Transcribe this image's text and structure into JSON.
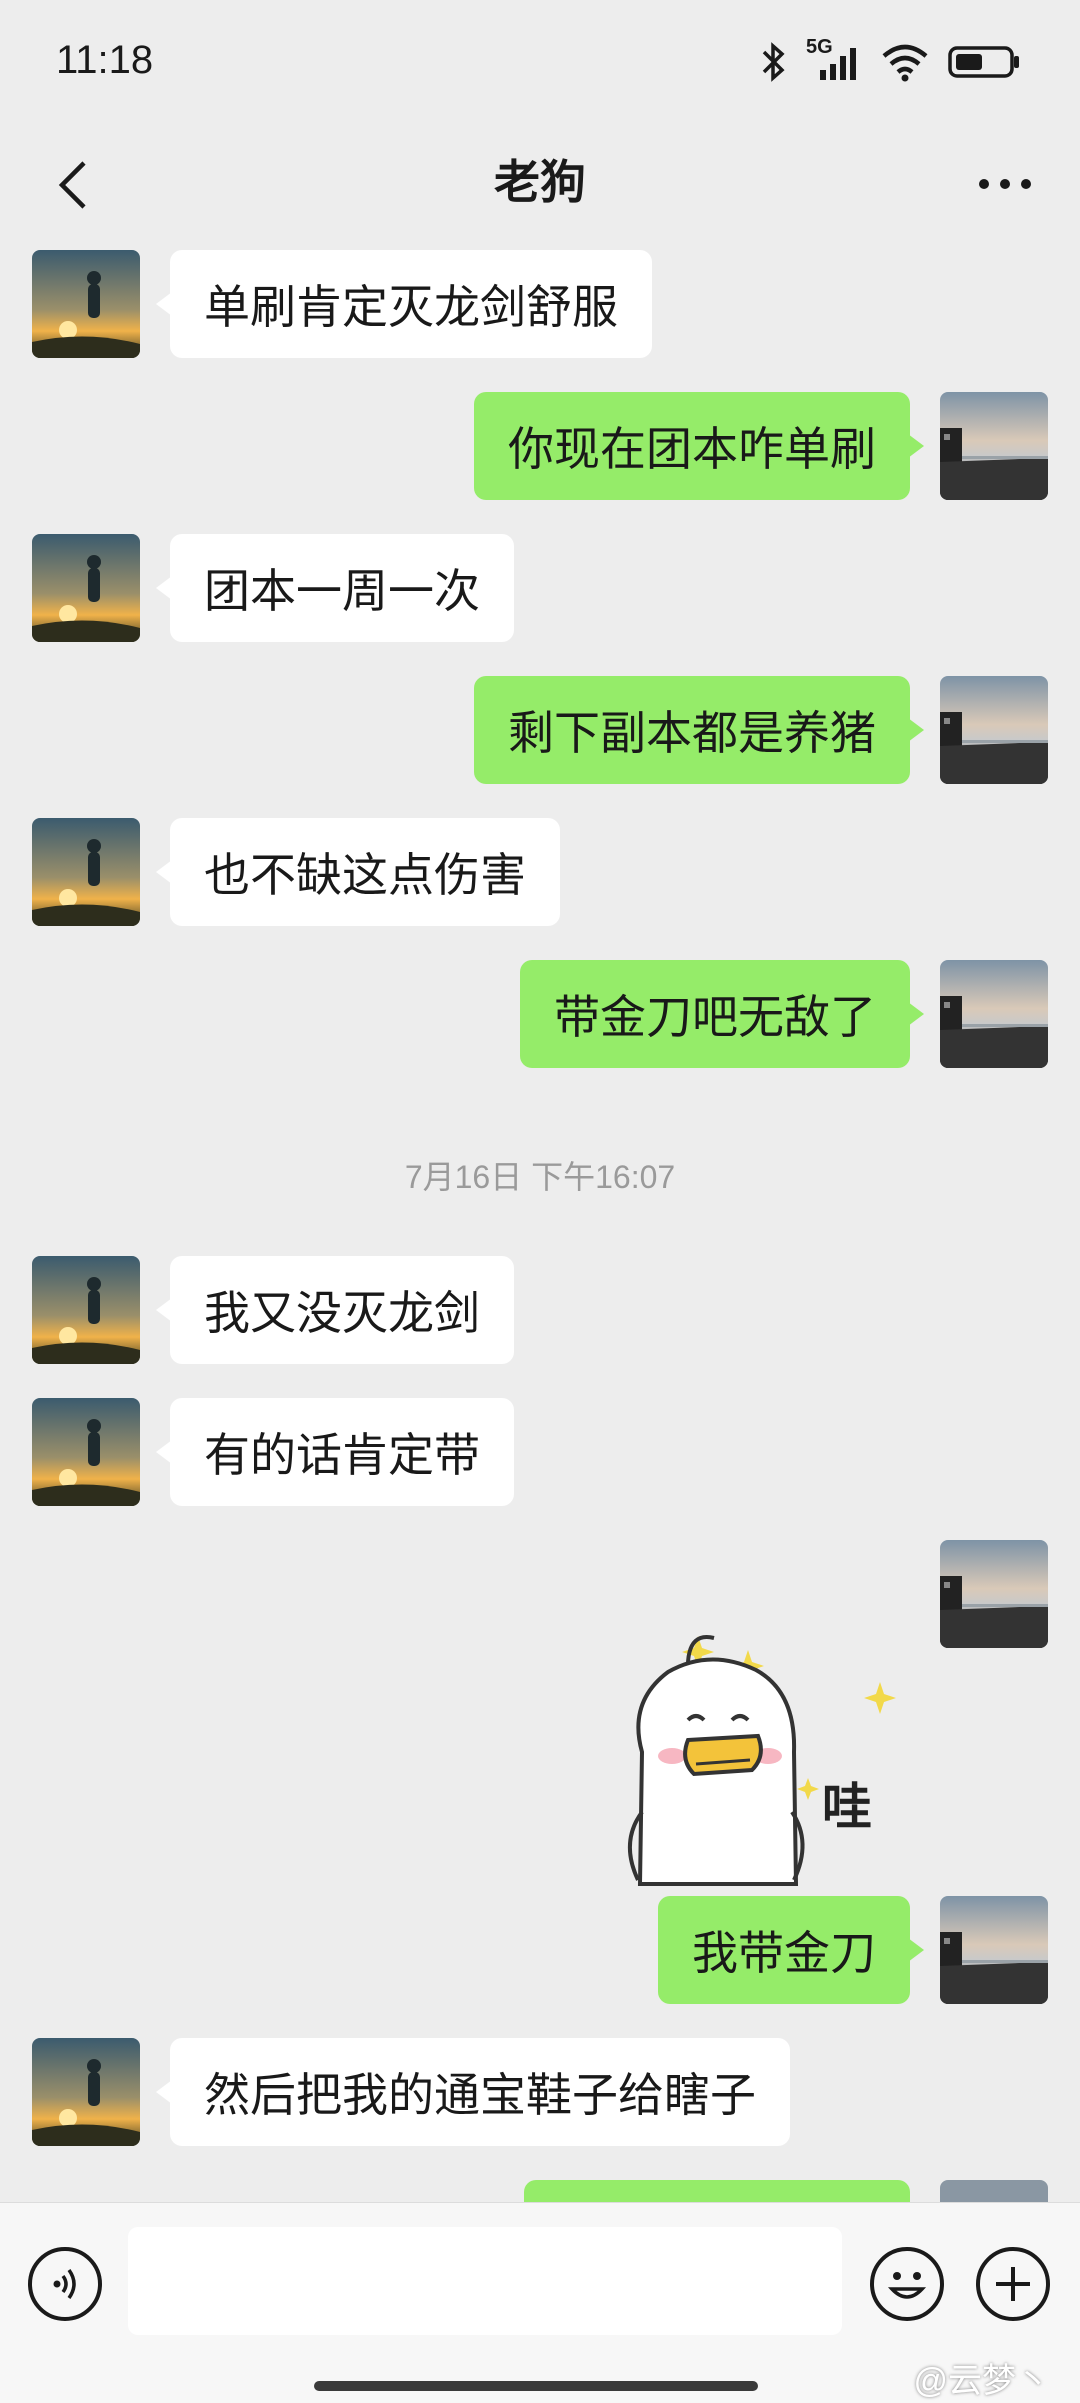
{
  "status_bar": {
    "time": "11:18",
    "network": "5G"
  },
  "header": {
    "title": "老狗"
  },
  "messages": [
    {
      "side": "left",
      "text": "单刷肯定灭龙剑舒服"
    },
    {
      "side": "right",
      "text": "你现在团本咋单刷"
    },
    {
      "side": "left",
      "text": "团本一周一次"
    },
    {
      "side": "right",
      "text": "剩下副本都是养猪"
    },
    {
      "side": "left",
      "text": "也不缺这点伤害"
    },
    {
      "side": "right",
      "text": "带金刀吧无敌了"
    },
    {
      "side": "left",
      "text": "我又没灭龙剑"
    },
    {
      "side": "left",
      "text": "有的话肯定带"
    },
    {
      "side": "right",
      "text": "我带金刀"
    },
    {
      "side": "left",
      "text": "然后把我的通宝鞋子给瞎子"
    }
  ],
  "timestamp": "7月16日 下午16:07",
  "sticker": {
    "caption": "哇",
    "icon": "duck-mouth-sticker"
  },
  "input": {
    "value": "",
    "placeholder": ""
  },
  "watermark": "@云梦丶",
  "colors": {
    "background": "#ededed",
    "sent_bubble": "#95ec69",
    "received_bubble": "#ffffff"
  }
}
